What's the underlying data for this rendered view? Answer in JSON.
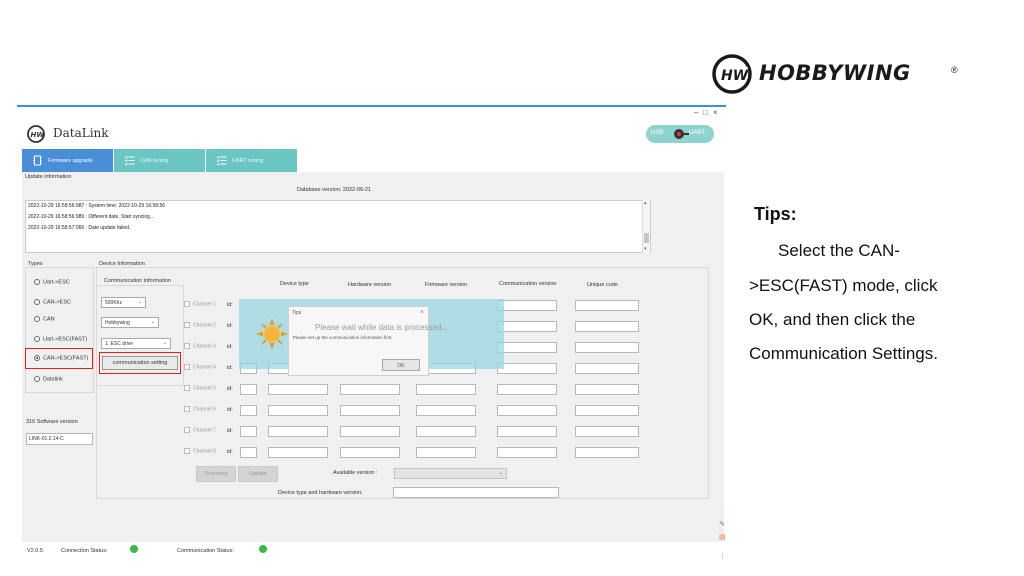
{
  "brand": {
    "name": "HOBBYWING",
    "registered": "®",
    "logo_icon": "hobbywing-hw-logo",
    "accent": "#3a8fd8"
  },
  "window": {
    "controls": [
      "–",
      "□",
      "×"
    ]
  },
  "app": {
    "title": "DataLink",
    "connection": {
      "left": "USB",
      "right": "UART"
    },
    "tabs": [
      {
        "label": "Firmware upgrade",
        "icon": "chip-icon",
        "active": true
      },
      {
        "label": "CAN tuning",
        "icon": "list-icon",
        "active": false
      },
      {
        "label": "UART tuning",
        "icon": "list-icon",
        "active": false
      }
    ],
    "update_info": {
      "label": "Update information",
      "db_version": "Database version: 2022-06-21",
      "log": [
        "2022-10-29 16:58:56:987 : System time: 2022-10-29 16:58:56",
        "2022-10-29 16:58:56:989 : Different date, Start syncing...",
        "2022-10-29 16:58:57:066 : Date update failed."
      ]
    },
    "types": {
      "label": "Types",
      "options": [
        "Uart->ESC",
        "CAN->ESC",
        "CAN",
        "Uart->ESC(FAST)",
        "CAN->ESC(FAST)",
        "Datalink"
      ],
      "selected": "CAN->ESC(FAST)"
    },
    "software": {
      "label": "316 Software version",
      "value": "LINK-01.2.14-C"
    },
    "device_info": {
      "label": "Device Information",
      "comm_info_label": "Communication information",
      "baud": "500Khz",
      "brand": "Hobbywing",
      "drive": "1. ESC drive",
      "comm_button": "communication setting",
      "columns": [
        "Device type",
        "Hardware version",
        "Firmware version",
        "Communication version",
        "Unique code"
      ],
      "channels": [
        "Channel 1",
        "Channel 2",
        "Channel 3",
        "Channel 4",
        "Channel 5",
        "Channel 6",
        "Channel 7",
        "Channel 8"
      ],
      "id_label": "id:",
      "scanning": "Scanning",
      "update": "Update",
      "available_version": "Available version :",
      "device_hw_version": "Device type and hardware version:"
    },
    "dialog": {
      "title": "Tips",
      "close": "×",
      "message": "Please wait while data is processed...",
      "sub": "Please set up the communication information first.",
      "ok": "OK"
    },
    "status": {
      "version": "V2.0.5",
      "connection": "Connection Status:",
      "communication": "Communication Status:",
      "ok_color": "#3cb84a"
    }
  },
  "tips": {
    "title": "Tips:",
    "lines": [
      "Select the CAN-",
      ">ESC(FAST) mode, click",
      "OK, and then click the",
      "Communication Settings."
    ]
  }
}
